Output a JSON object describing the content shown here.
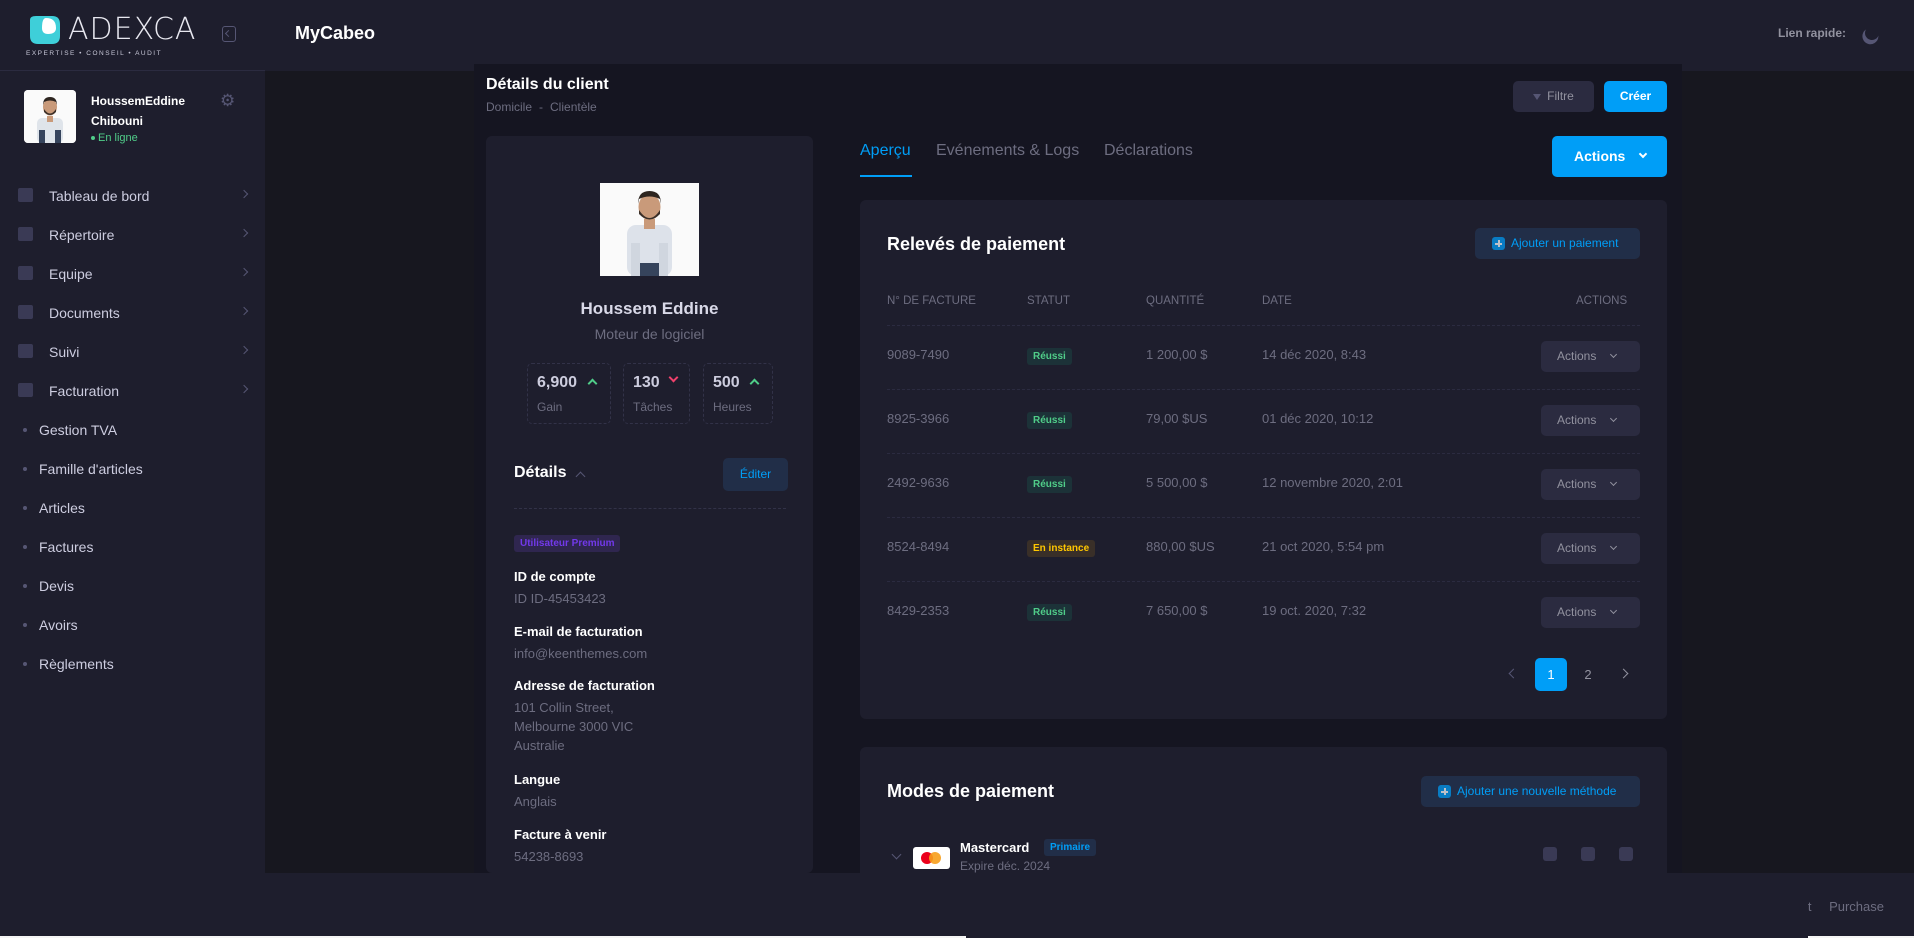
{
  "brand": {
    "logo_main": "ADEXCA",
    "logo_tagline": "EXPERTISE • CONSEIL • AUDIT"
  },
  "app": {
    "title": "MyCabeo",
    "quick_link": "Lien rapide:"
  },
  "user": {
    "first_line": "HoussemEddine",
    "second_line": "Chibouni",
    "status": "En ligne"
  },
  "sidebar": {
    "items": [
      {
        "label": "Tableau de bord"
      },
      {
        "label": "Répertoire"
      },
      {
        "label": "Equipe"
      },
      {
        "label": "Documents"
      },
      {
        "label": "Suivi"
      },
      {
        "label": "Facturation"
      }
    ],
    "subitems": [
      {
        "label": "Gestion TVA"
      },
      {
        "label": "Famille d'articles"
      },
      {
        "label": "Articles"
      },
      {
        "label": "Factures"
      },
      {
        "label": "Devis"
      },
      {
        "label": "Avoirs"
      },
      {
        "label": "Règlements"
      }
    ]
  },
  "page": {
    "title": "Détails du client",
    "breadcrumb": [
      "Domicile",
      "-",
      "Clientèle"
    ],
    "filter_label": "Filtre",
    "create_label": "Créer"
  },
  "profile": {
    "name": "Houssem Eddine",
    "role": "Moteur de logiciel",
    "stats": [
      {
        "value": "6,900",
        "label": "Gain",
        "trend": "up"
      },
      {
        "value": "130",
        "label": "Tâches",
        "trend": "down"
      },
      {
        "value": "500",
        "label": "Heures",
        "trend": "up"
      }
    ],
    "details_title": "Détails",
    "edit_label": "Éditer",
    "premium_badge": "Utilisateur Premium",
    "fields": [
      {
        "key": "ID de compte",
        "value": "ID ID-45453423"
      },
      {
        "key": "E-mail de facturation",
        "value": "info@keenthemes.com"
      },
      {
        "key": "Adresse de facturation",
        "value": "101 Collin Street,",
        "value2": "Melbourne 3000 VIC",
        "value3": "Australie"
      },
      {
        "key": "Langue",
        "value": "Anglais"
      },
      {
        "key": "Facture à venir",
        "value": "54238-8693"
      }
    ]
  },
  "tabs": [
    {
      "label": "Aperçu"
    },
    {
      "label": "Evénements & Logs"
    },
    {
      "label": "Déclarations"
    }
  ],
  "actions_label": "Actions",
  "payments": {
    "title": "Relevés de paiement",
    "add_label": "Ajouter un paiement",
    "headers": [
      "N° DE FACTURE",
      "STATUT",
      "QUANTITÉ",
      "DATE",
      "ACTIONS"
    ],
    "rows": [
      {
        "invoice": "9089-7490",
        "status": "Réussi",
        "status_type": "ok",
        "amount": "1 200,00 $",
        "date": "14 déc 2020, 8:43",
        "action": "Actions"
      },
      {
        "invoice": "8925-3966",
        "status": "Réussi",
        "status_type": "ok",
        "amount": "79,00 $US",
        "date": "01 déc 2020, 10:12",
        "action": "Actions"
      },
      {
        "invoice": "2492-9636",
        "status": "Réussi",
        "status_type": "ok",
        "amount": "5 500,00 $",
        "date": "12 novembre 2020, 2:01",
        "action": "Actions"
      },
      {
        "invoice": "8524-8494",
        "status": "En instance",
        "status_type": "wait",
        "amount": "880,00 $US",
        "date": "21 oct 2020, 5:54 pm",
        "action": "Actions"
      },
      {
        "invoice": "8429-2353",
        "status": "Réussi",
        "status_type": "ok",
        "amount": "7 650,00 $",
        "date": "19 oct. 2020, 7:32",
        "action": "Actions"
      }
    ],
    "pages": [
      "1",
      "2"
    ],
    "current_page": "1"
  },
  "methods": {
    "title": "Modes de paiement",
    "add_label": "Ajouter une nouvelle méthode",
    "card_name": "Mastercard",
    "card_badge": "Primaire",
    "card_expiry": "Expire déc. 2024"
  },
  "footer": {
    "links": [
      "t",
      "Purchase"
    ]
  },
  "colors": {
    "accent": "#009ef7",
    "success": "#50cd89",
    "danger": "#f1416c",
    "warning": "#ffc700",
    "premium": "#7239ea"
  }
}
